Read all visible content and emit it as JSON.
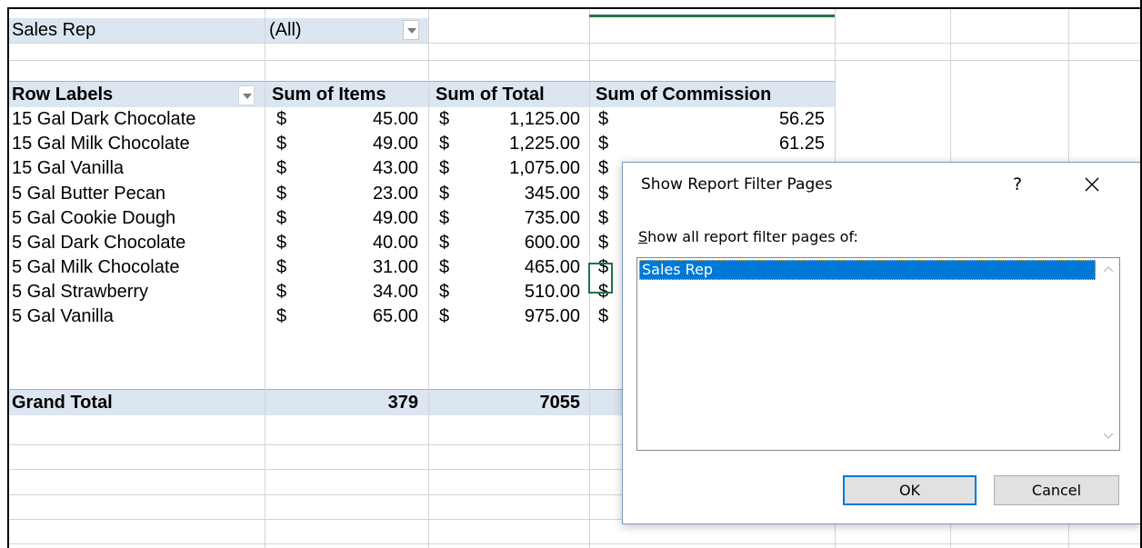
{
  "filter": {
    "field_label": "Sales Rep",
    "field_value": "(All)"
  },
  "pivot": {
    "headers": [
      "Row Labels",
      "Sum of Items",
      "Sum of Total",
      "Sum of Commission"
    ],
    "currency_symbol": "$",
    "rows": [
      {
        "label": "15 Gal Dark Chocolate",
        "items": "45.00",
        "total": "1,125.00",
        "commission": "56.25"
      },
      {
        "label": "15 Gal Milk Chocolate",
        "items": "49.00",
        "total": "1,225.00",
        "commission": "61.25"
      },
      {
        "label": "15 Gal Vanilla",
        "items": "43.00",
        "total": "1,075.00",
        "commission": ""
      },
      {
        "label": "5 Gal Butter Pecan",
        "items": "23.00",
        "total": "345.00",
        "commission": ""
      },
      {
        "label": "5 Gal Cookie Dough",
        "items": "49.00",
        "total": "735.00",
        "commission": ""
      },
      {
        "label": "5 Gal Dark Chocolate",
        "items": "40.00",
        "total": "600.00",
        "commission": ""
      },
      {
        "label": "5 Gal Milk Chocolate",
        "items": "31.00",
        "total": "465.00",
        "commission": ""
      },
      {
        "label": "5 Gal Strawberry",
        "items": "34.00",
        "total": "510.00",
        "commission": ""
      },
      {
        "label": "5 Gal Vanilla",
        "items": "65.00",
        "total": "975.00",
        "commission": ""
      }
    ],
    "grand_total": {
      "label": "Grand Total",
      "items": "379",
      "total": "7055"
    }
  },
  "dialog": {
    "title": "Show Report Filter Pages",
    "help_label": "?",
    "prompt_accel": "S",
    "prompt_rest": "how all report filter pages of:",
    "list_items": [
      "Sales Rep"
    ],
    "ok_label": "OK",
    "cancel_label": "Cancel"
  },
  "colors": {
    "pivot_header_fill": "#dce6f1",
    "selection_accent": "#217346",
    "list_selected": "#0078d7"
  },
  "icons": [
    "dropdown-arrow-icon",
    "close-icon",
    "scroll-up-icon",
    "scroll-down-icon"
  ]
}
